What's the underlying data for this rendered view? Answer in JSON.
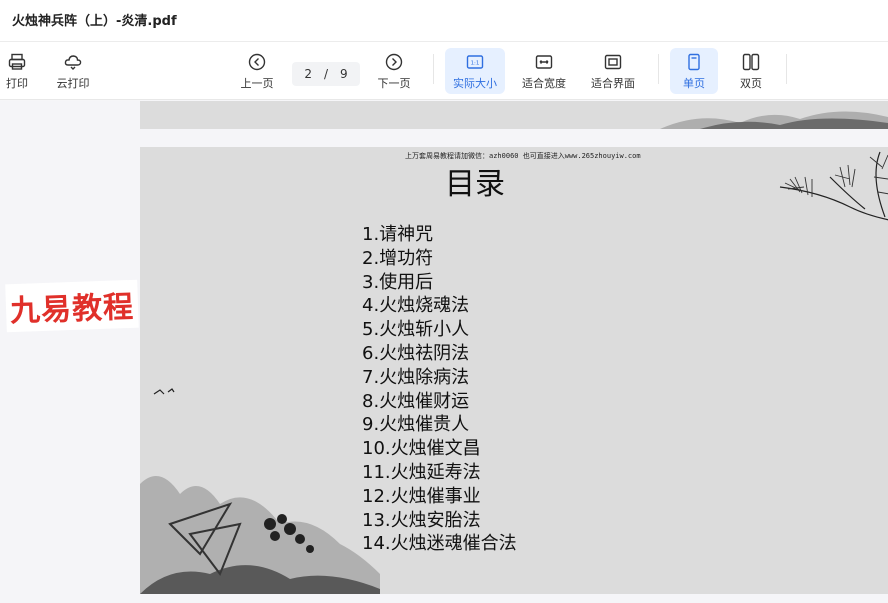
{
  "window": {
    "title": "火烛神兵阵（上）-炎清.pdf"
  },
  "toolbar": {
    "print": "打印",
    "cloud_print": "云打印",
    "prev_page": "上一页",
    "current_page": "2",
    "page_separator": "/",
    "total_pages": "9",
    "next_page": "下一页",
    "actual_size": "实际大小",
    "fit_width": "适合宽度",
    "fit_window": "适合界面",
    "single_page": "单页",
    "double_page": "双页"
  },
  "document": {
    "header_text": "上万套周易教程请加微信：azh0060   也可直接进入www.265zhouyiw.com",
    "toc_title": "目录",
    "toc_items": [
      "1.请神咒",
      "2.增功符",
      "3.使用后",
      "4.火烛烧魂法",
      "5.火烛斩小人",
      "6.火烛祛阴法",
      "7.火烛除病法",
      "8.火烛催财运",
      "9.火烛催贵人",
      "10.火烛催文昌",
      "11.火烛延寿法",
      "12.火烛催事业",
      "13.火烛安胎法",
      "14.火烛迷魂催合法"
    ]
  },
  "overlay": {
    "watermark": "九易教程"
  },
  "colors": {
    "accent": "#2f6fe0",
    "active_bg": "#e6f0ff",
    "watermark": "#e0302a"
  }
}
